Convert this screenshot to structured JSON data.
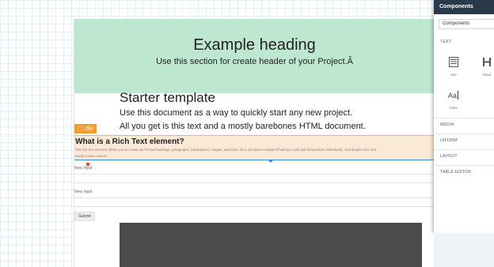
{
  "hero": {
    "heading": "Example heading",
    "subtext": "Use this section for create header of your Project.Â"
  },
  "starter": {
    "title": "Starter template",
    "line1": "Use this document as a way to quickly start any new project.",
    "line2": "All you get is this text and a mostly barebones HTML document."
  },
  "selection_badge": "div",
  "rich_text": {
    "title": "What is a Rich Text element?",
    "body_line1": "The rich text element allows you to create and format headings, paragraphs, blockquotes, images, and video all in one place instead of having to add and format them individually. Just double-click and",
    "body_line2": "easily create content."
  },
  "form": {
    "input1_label": "New Input",
    "input2_label": "New Input",
    "submit_label": "Submit"
  },
  "components_panel": {
    "title": "Components",
    "search_value": "Components",
    "sections": [
      "TEXT",
      "MEDIA",
      "UIFORM",
      "LAYOUT",
      "TABLE EDITOR"
    ],
    "items": [
      {
        "label": "text",
        "icon": "text-block-icon"
      },
      {
        "label": "head",
        "icon": "heading-icon"
      },
      {
        "label": "label",
        "icon": "label-aa-icon"
      }
    ]
  },
  "colors": {
    "hero_bg": "#bde8cf",
    "selection_orange": "#f39c2c",
    "selection_blue": "#2f8fd8",
    "panel_header": "#2b3a4a"
  }
}
